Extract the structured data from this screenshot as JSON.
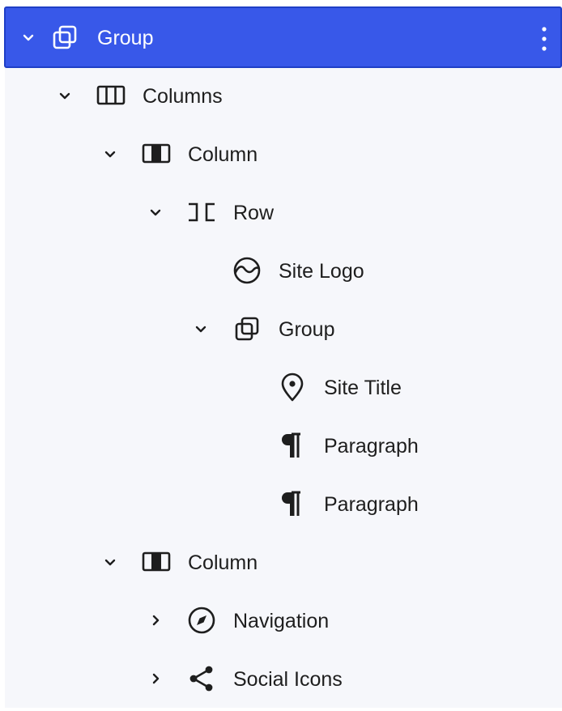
{
  "list_view": {
    "items": [
      {
        "label": "Group",
        "icon": "group-icon",
        "toggle": "chevron-down-icon",
        "selected": true
      },
      {
        "label": "Columns",
        "icon": "columns-icon",
        "toggle": "chevron-down-icon"
      },
      {
        "label": "Column",
        "icon": "column-icon",
        "toggle": "chevron-down-icon"
      },
      {
        "label": "Row",
        "icon": "row-icon",
        "toggle": "chevron-down-icon"
      },
      {
        "label": "Site Logo",
        "icon": "site-logo-icon"
      },
      {
        "label": "Group",
        "icon": "group-icon",
        "toggle": "chevron-down-icon"
      },
      {
        "label": "Site Title",
        "icon": "map-pin-icon"
      },
      {
        "label": "Paragraph",
        "icon": "paragraph-icon"
      },
      {
        "label": "Paragraph",
        "icon": "paragraph-icon"
      },
      {
        "label": "Column",
        "icon": "column-icon",
        "toggle": "chevron-down-icon"
      },
      {
        "label": "Navigation",
        "icon": "navigation-icon",
        "toggle": "chevron-right-icon"
      },
      {
        "label": "Social Icons",
        "icon": "share-icon",
        "toggle": "chevron-right-icon"
      }
    ]
  },
  "colors": {
    "selected_bg": "#3858e9",
    "panel_bg": "#f6f7fb",
    "text": "#1e1e1e"
  }
}
